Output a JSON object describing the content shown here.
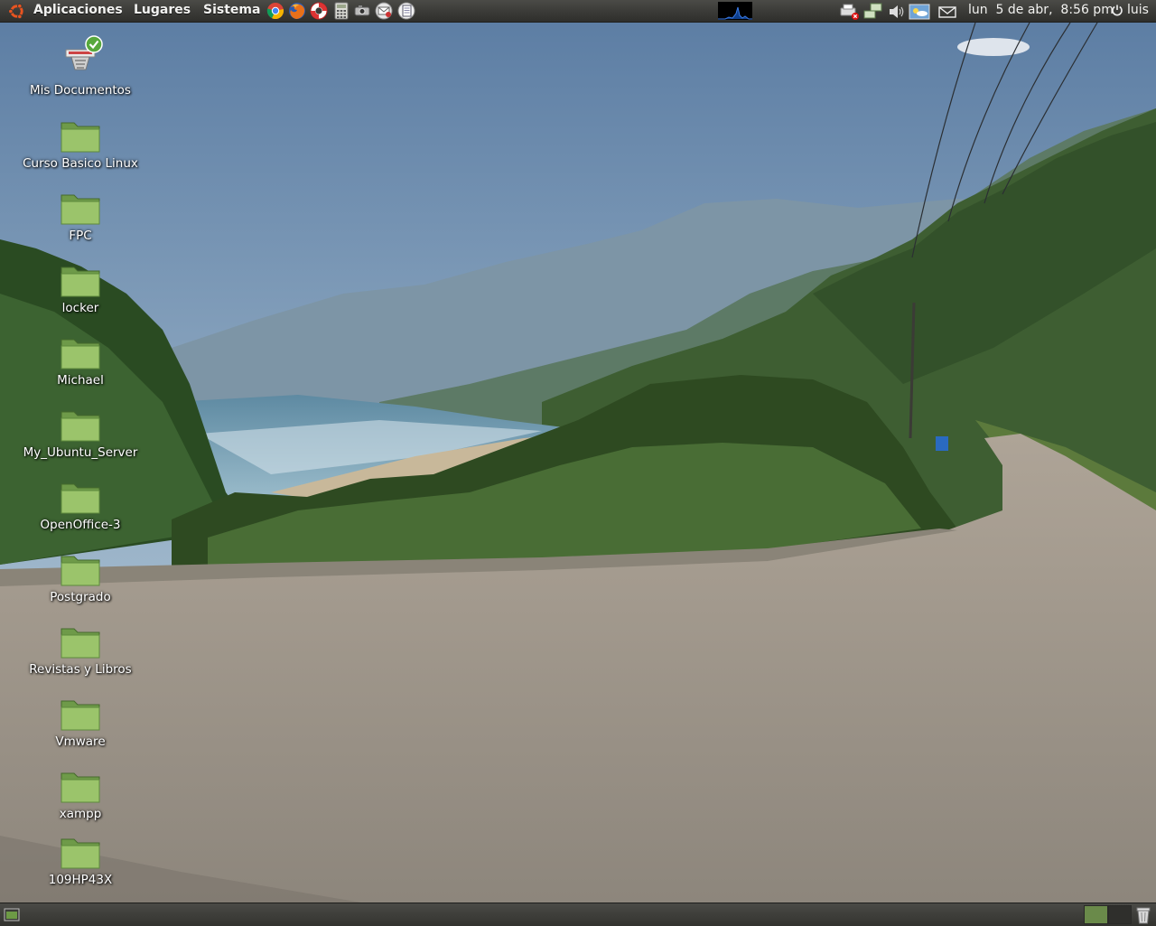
{
  "top_panel": {
    "menus": [
      "Aplicaciones",
      "Lugares",
      "Sistema"
    ],
    "launchers": [
      "chrome-icon",
      "firefox-icon",
      "help-lifebuoy-icon",
      "calculator-icon",
      "screenshot-camera-icon",
      "mail-client-icon",
      "document-viewer-icon"
    ],
    "clock": "lun  5 de abr,  8:56 pm",
    "user": "luis",
    "accent": "#e95420"
  },
  "desktop": {
    "icons": [
      {
        "label": "Mis Documentos",
        "icon": "network-share-icon"
      },
      {
        "label": "Curso Basico Linux",
        "icon": "folder-icon"
      },
      {
        "label": "FPC",
        "icon": "folder-icon"
      },
      {
        "label": "locker",
        "icon": "folder-icon"
      },
      {
        "label": "Michael",
        "icon": "folder-icon"
      },
      {
        "label": "My_Ubuntu_Server",
        "icon": "folder-icon"
      },
      {
        "label": "OpenOffice-3",
        "icon": "folder-icon"
      },
      {
        "label": "Postgrado",
        "icon": "folder-icon"
      },
      {
        "label": "Revistas y Libros",
        "icon": "folder-icon"
      },
      {
        "label": "Vmware",
        "icon": "folder-icon"
      },
      {
        "label": "xampp",
        "icon": "folder-icon"
      },
      {
        "label": "109HP43X",
        "icon": "folder-icon"
      }
    ]
  },
  "bottom_panel": {
    "workspaces": 2,
    "active_workspace": 1
  }
}
